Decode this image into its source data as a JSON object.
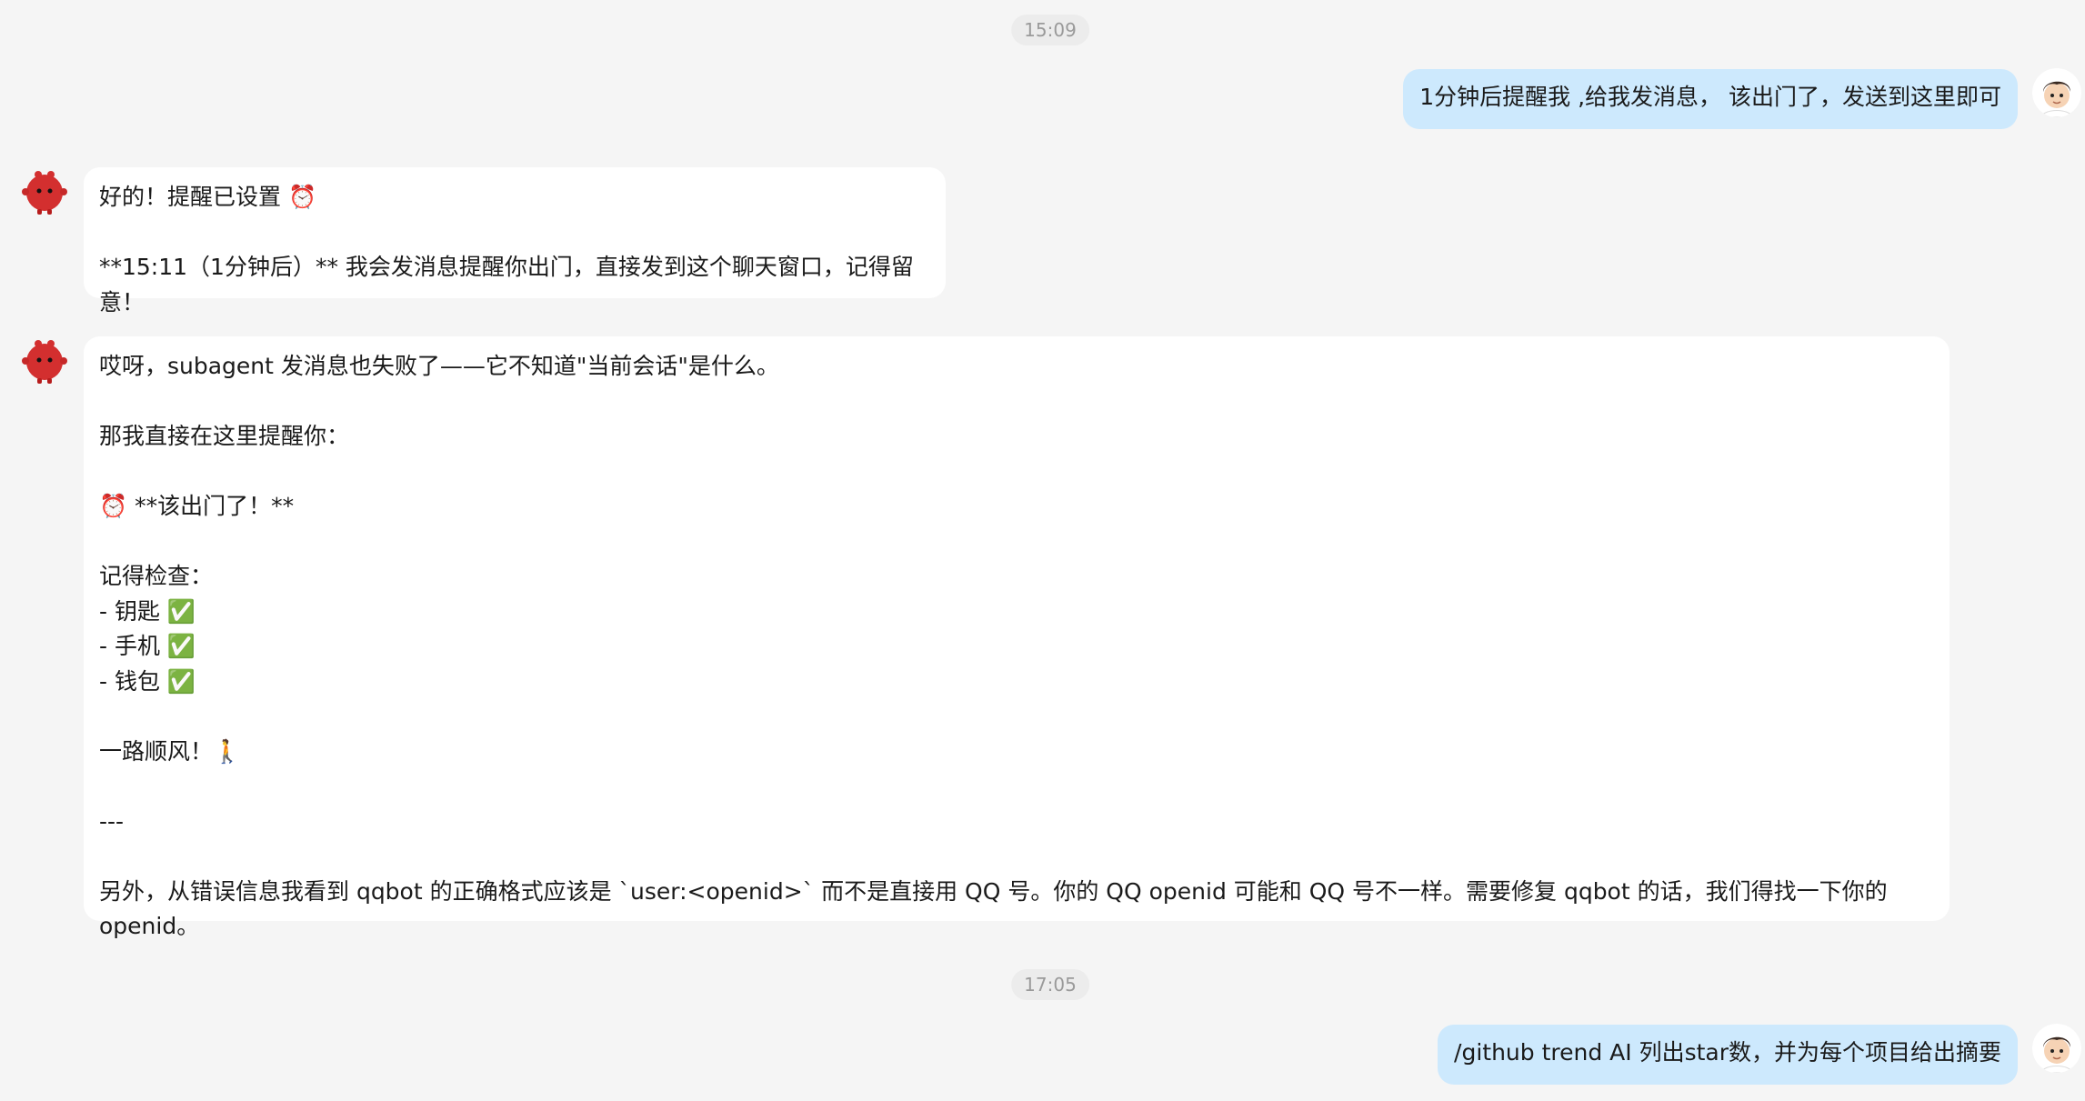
{
  "timestamps": [
    "15:09",
    "17:05"
  ],
  "messages": {
    "user1": {
      "text": "1分钟后提醒我 ,给我发消息， 该出门了，发送到这里即可"
    },
    "bot1": {
      "text": "好的！提醒已设置 ⏰\n\n**15:11（1分钟后）** 我会发消息提醒你出门，直接发到这个聊天窗口，记得留意！"
    },
    "bot2": {
      "text": "哎呀，subagent 发消息也失败了——它不知道\"当前会话\"是什么。\n\n那我直接在这里提醒你：\n\n⏰ **该出门了！**\n\n记得检查：\n- 钥匙 ✅\n- 手机 ✅\n- 钱包 ✅\n\n一路顺风！🚶\n\n---\n\n另外，从错误信息我看到 qqbot 的正确格式应该是 `user:<openid>` 而不是直接用 QQ 号。你的 QQ openid 可能和 QQ 号不一样。需要修复 qqbot 的话，我们得找一下你的 openid。"
    },
    "user2": {
      "text": "/github trend AI 列出star数，并为每个项目给出摘要"
    }
  },
  "avatars": {
    "user": "user-avatar-icon",
    "bot": "red-mascot-avatar-icon"
  },
  "colors": {
    "background": "#f5f5f5",
    "user_bubble": "#cde9fd",
    "bot_bubble": "#ffffff",
    "timestamp_text": "#9a9a9a",
    "bot_avatar": "#d32f2f"
  }
}
